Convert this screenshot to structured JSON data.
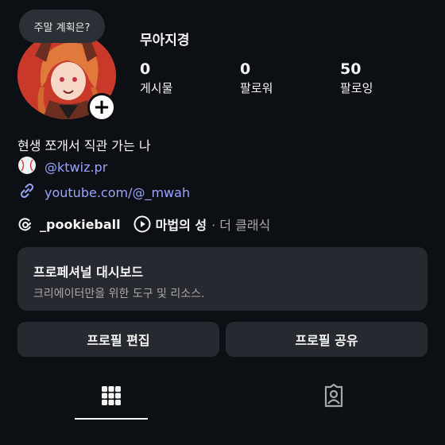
{
  "profile": {
    "note": "주말 계획은?",
    "username": "무아지경",
    "stats": [
      {
        "value": "0",
        "label": "게시물"
      },
      {
        "value": "0",
        "label": "팔로워"
      },
      {
        "value": "50",
        "label": "팔로잉"
      }
    ],
    "bio": "현생 쪼개서 직관 가는 나",
    "mention": "@ktwiz.pr",
    "link": "youtube.com/@_mwah",
    "threads_handle": "_pookieball",
    "music_title": "마법의 성",
    "music_artist": "· 더 클래식"
  },
  "dashboard": {
    "title": "프로페셔널 대시보드",
    "subtitle": "크리에이터만을 위한 도구 및 리소스."
  },
  "buttons": {
    "edit": "프로필 편집",
    "share": "프로필 공유"
  },
  "tabs": {
    "active": "grid",
    "icons": [
      "grid-icon",
      "tagged-icon"
    ]
  },
  "colors": {
    "background": "#0c1014",
    "card": "#262a30",
    "link": "#9aa3ff",
    "avatar_bg": "#c23a2b"
  }
}
